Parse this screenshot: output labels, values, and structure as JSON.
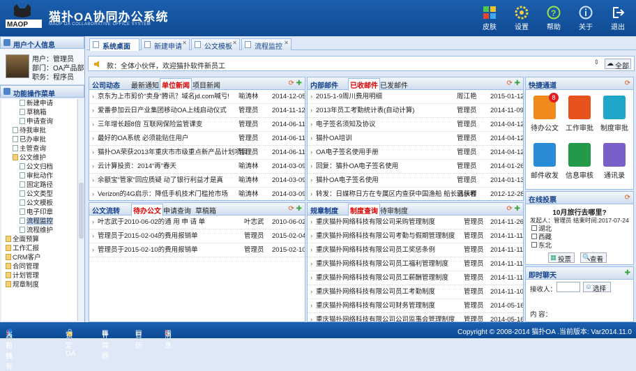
{
  "app": {
    "title": "猫扑OA协同办公系统",
    "subtitle": "MAOP OA COLLABORATIVE OFFICE SYSTEM",
    "logo_text": "MAOP"
  },
  "header": {
    "buttons": [
      {
        "label": "皮肤",
        "icon": "skin-icon"
      },
      {
        "label": "设置",
        "icon": "gear-icon"
      },
      {
        "label": "帮助",
        "icon": "help-icon"
      },
      {
        "label": "关于",
        "icon": "info-icon"
      },
      {
        "label": "退出",
        "icon": "exit-icon"
      }
    ]
  },
  "user_panel": {
    "title": "用户个人信息",
    "user": "用户：管理员",
    "dept": "部门：OA产品部",
    "duty": "职务：程序员"
  },
  "menu_panel": {
    "title": "功能操作菜单",
    "items": [
      "新建申请",
      "草稿箱",
      "申请查询",
      "待我审批",
      "已办审批",
      "主管查询",
      "公文维护",
      "公文归档",
      "审批动作",
      "固定路径",
      "公文类型",
      "公文模板",
      "电子印章",
      "流程监控",
      "流程维护",
      "全面预算",
      "工作汇报",
      "CRM客户",
      "合同管理",
      "计划管理",
      "规章制度"
    ]
  },
  "tabs": [
    {
      "label": "系统桌面",
      "active": true
    },
    {
      "label": "新建申请"
    },
    {
      "label": "公文模板"
    },
    {
      "label": "流程监控"
    }
  ],
  "notice": {
    "text": "款：全体小伙伴，欢迎猫扑软件新员工",
    "all": "全部"
  },
  "news": {
    "tabs": [
      "公司动态",
      "最新通知",
      "单位新闻",
      "项目新闻"
    ],
    "rows": [
      [
        "京东为上市剪价“卖身”腾讯？域名jd.com喊亏!",
        "喻涛林",
        "2014-12-05"
      ],
      [
        "爱番参加云日产业集团移动OA上线启动仪式",
        "管理员",
        "2014-11-12"
      ],
      [
        "三年增长超8倍 互联网保险监管课变",
        "管理员",
        "2014-06-11"
      ],
      [
        "最好的OA系统 必须能贴住用户",
        "管理员",
        "2014-06-11"
      ],
      [
        "猫扑OA荣获2013年重庆市市级重点新产品计划项目",
        "管理员",
        "2014-06-11"
      ],
      [
        "云计算投资：2014“再”春天",
        "喻涛林",
        "2014-03-09"
      ],
      [
        "余额宝“管家”回应质疑 动了银行利益才是真",
        "喻涛林",
        "2014-03-09"
      ],
      [
        "Verizon的4G启示：降低手机技术门槛抢市场",
        "喻涛林",
        "2014-03-09"
      ]
    ]
  },
  "mail": {
    "tabs": [
      "内部邮件",
      "已收邮件",
      "已发邮件"
    ],
    "rows": [
      [
        "2015-1-9周川费用明细",
        "周江艳",
        "2015-01-12"
      ],
      [
        "2013年员工考勤统计表(自动计算)",
        "管理员",
        "2014-11-09"
      ],
      [
        "电子签名须知及协议",
        "管理员",
        "2014-04-12"
      ],
      [
        "猫扑OA培训",
        "管理员",
        "2014-04-12"
      ],
      [
        "OA电子签名使用手册",
        "管理员",
        "2014-04-12"
      ],
      [
        "回复：猫扑OA电子签名使用",
        "管理员",
        "2014-01-26"
      ],
      [
        "猫扑OA电子签名使用",
        "管理员",
        "2014-01-13"
      ],
      [
        "转发：日媒称日方在专属区内查获中国渔船 船长已获释",
        "满示者",
        "2012-12-28"
      ]
    ]
  },
  "shortcut": {
    "title": "快捷通道",
    "items": [
      {
        "label": "待办公文",
        "badge": "8",
        "color": "#f08a1c"
      },
      {
        "label": "工作审批",
        "color": "#e8531d"
      },
      {
        "label": "制度审批",
        "color": "#20a6c9"
      },
      {
        "label": "邮件收发",
        "color": "#2a8bd6"
      },
      {
        "label": "信息审核",
        "color": "#23994a"
      },
      {
        "label": "通讯录",
        "color": "#7a5fc9"
      }
    ]
  },
  "doc": {
    "tabs": [
      "公文流转",
      "待办公文",
      "申请查询",
      "草稿箱"
    ],
    "rows": [
      [
        "叶志武于2010-06-02的通 用 申 请 单",
        "叶志武",
        "2010-06-02"
      ],
      [
        "管理员于2015-02-04的费用报销单",
        "管理员",
        "2015-02-04"
      ],
      [
        "管理员于2015-02-10的费用报销单",
        "管理员",
        "2015-02-10"
      ]
    ]
  },
  "rules": {
    "tabs": [
      "规章制度",
      "制度查询",
      "待审制度"
    ],
    "rows": [
      [
        "重庆猫扑网络科技有限公司采购管理制度",
        "管理员",
        "2014-11-26"
      ],
      [
        "重庆猫扑网络科技有限公司考勤与假期管理制度",
        "管理员",
        "2014-11-11"
      ],
      [
        "重庆猫扑网络科技有限公司员工奖惩条例",
        "管理员",
        "2014-11-11"
      ],
      [
        "重庆猫扑网络科技有限公司员工福利管理制度",
        "管理员",
        "2014-11-11"
      ],
      [
        "重庆猫扑网络科技有限公司员工薪酬管理制度",
        "管理员",
        "2014-11-11"
      ],
      [
        "重庆猫扑网络科技有限公司员工考勤制度",
        "管理员",
        "2014-11-10"
      ],
      [
        "重庆猫扑网络科技有限公司财务管理制度",
        "管理员",
        "2014-05-16"
      ],
      [
        "重庆猫扑网络科技有限公司公司监事会管理制度",
        "管理员",
        "2014-05-16"
      ],
      [
        "重庆猫扑网络科技有限公司员工守则",
        "管理员",
        "2014-05-16"
      ]
    ]
  },
  "vote": {
    "title": "在线投票",
    "question": "10月旅行去哪里?",
    "meta": "发起人：管理员 结束时间:2017-07-24",
    "options": [
      "湖北",
      "西藏",
      "东北"
    ],
    "vote_btn": "投票",
    "view_btn": "查看"
  },
  "chat": {
    "title": "即时聊天",
    "receiver": "接收人：",
    "select_btn": "选择",
    "content": "内  容："
  },
  "footer": {
    "online": "当前共有",
    "online_count": "1",
    "online_suffix": "人在线",
    "lock": "锁定OA",
    "calc": "计算器",
    "calendar": "日历",
    "msg": "消息",
    "msg_count": "1",
    "copyright": "Copyright © 2008-2014 猫扑OA .当前版本: Var2014.11.0"
  }
}
